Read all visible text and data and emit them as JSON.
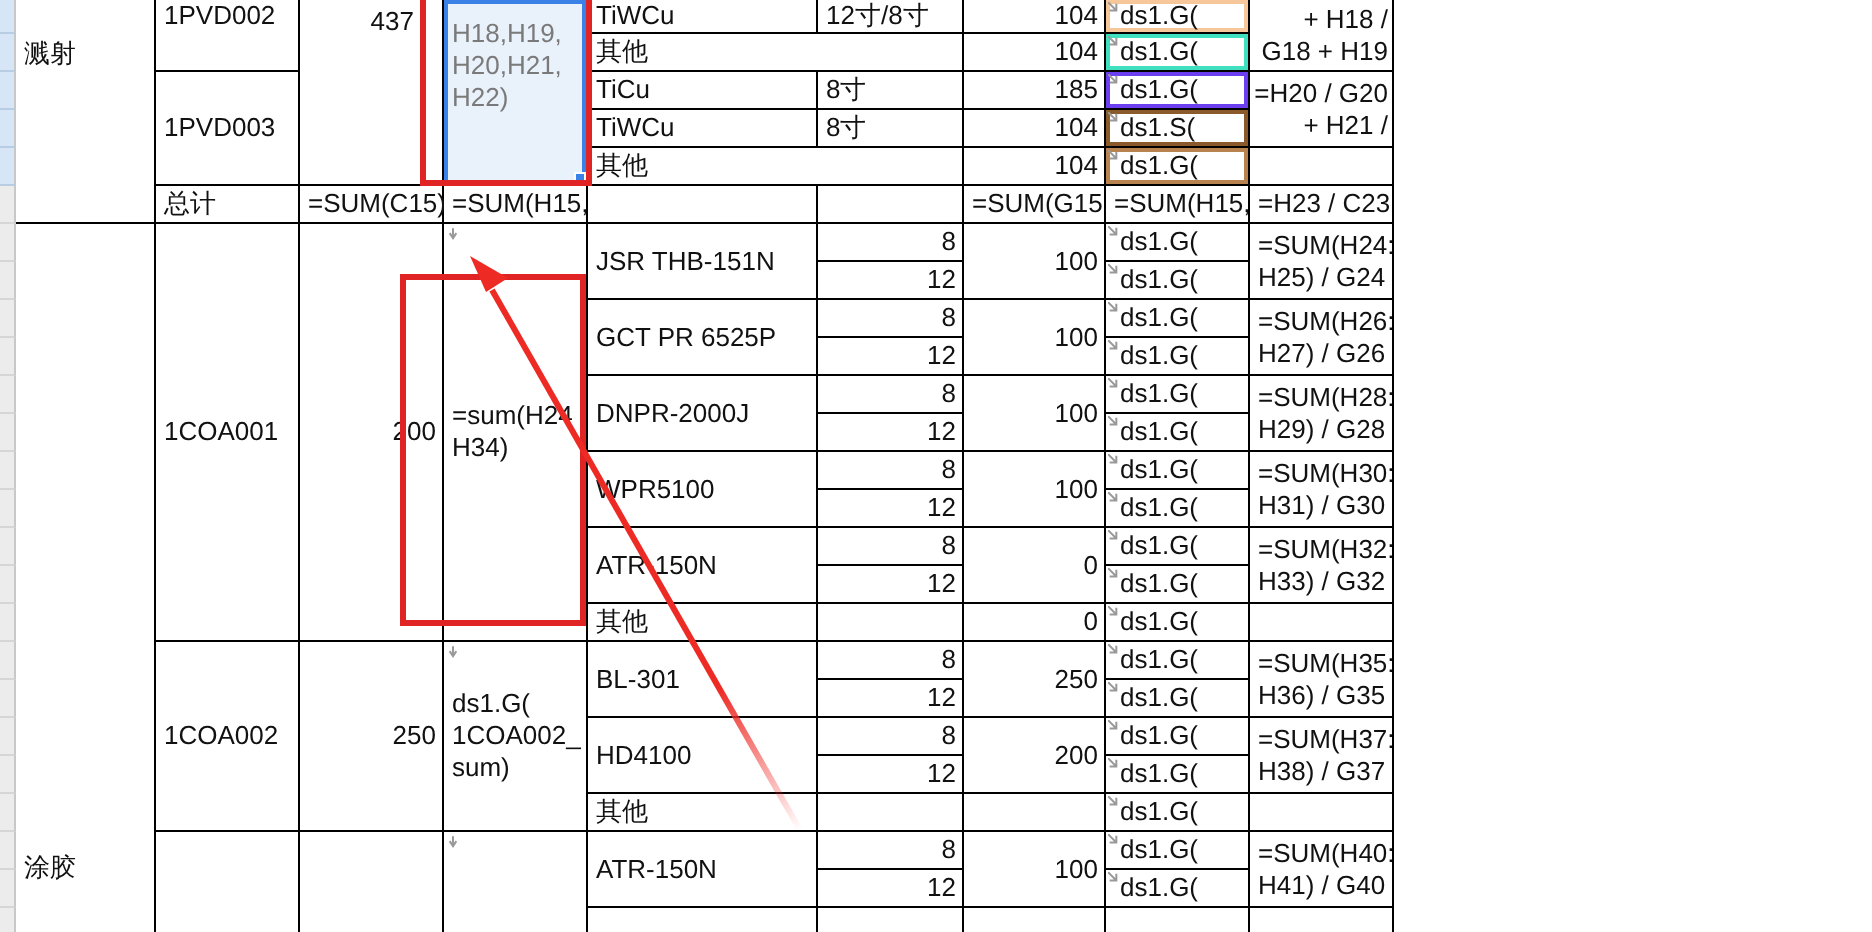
{
  "sheet": {
    "sections": [
      {
        "label": "溅射",
        "continues_above": true,
        "continues_below": false,
        "groups": [
          {
            "qty": "437",
            "formula": [
              "H18,H19,",
              "H20,H21,",
              "H22)"
            ],
            "selected": true,
            "items": [
              {
                "code": "1PVD002",
                "blocks": [
                  {
                    "ratio": [
                      "+ H18 /",
                      "G18 + H19"
                    ],
                    "products": [
                      {
                        "kind": "single",
                        "name": "TiWCu",
                        "amount": "104",
                        "rows": [
                          {
                            "size": "12寸/8寸",
                            "formula": "ds1.G(",
                            "color": "#f5c79a"
                          }
                        ]
                      },
                      {
                        "kind": "other",
                        "name": "其他",
                        "amount": "104",
                        "rows": [
                          {
                            "formula": "ds1.G(",
                            "color": "#3fe0c0"
                          }
                        ]
                      }
                    ]
                  }
                ]
              },
              {
                "code": "1PVD003",
                "blocks": [
                  {
                    "ratio": [
                      "=H20 / G20",
                      "+ H21 /"
                    ],
                    "products": [
                      {
                        "kind": "single",
                        "name": "TiCu",
                        "amount": "185",
                        "rows": [
                          {
                            "size": "8寸",
                            "formula": "ds1.G(",
                            "color": "#6b3ff0"
                          }
                        ]
                      },
                      {
                        "kind": "single",
                        "name": "TiWCu",
                        "amount": "104",
                        "rows": [
                          {
                            "size": "8寸",
                            "formula": "ds1.S(",
                            "color": "#8b5a2b"
                          }
                        ]
                      }
                    ]
                  },
                  {
                    "products": [
                      {
                        "kind": "other",
                        "name": "其他",
                        "amount": "104",
                        "rows": [
                          {
                            "formula": "ds1.G(",
                            "color": "#b8834f"
                          }
                        ]
                      }
                    ]
                  }
                ]
              }
            ]
          }
        ],
        "total": {
          "label": "总计",
          "qty": "=SUM(C15)",
          "formula": "=SUM(H15,",
          "amount": "=SUM(G15,",
          "sum": "=SUM(H15,",
          "ratio": "=H23 / C23"
        }
      },
      {
        "label": "涂胶",
        "continues_above": false,
        "continues_below": true,
        "groups": [
          {
            "qty": "200",
            "formula": [
              "=sum(H24",
              "H34)"
            ],
            "selected": false,
            "items": [
              {
                "code": "1COA001",
                "blocks": [
                  {
                    "ratio": [
                      "=SUM(H24:",
                      "H25) / G24"
                    ],
                    "products": [
                      {
                        "kind": "pair",
                        "name": "JSR THB-151N",
                        "amount": "100",
                        "rows": [
                          {
                            "size": "8",
                            "formula": "ds1.G("
                          },
                          {
                            "size": "12",
                            "formula": "ds1.G("
                          }
                        ]
                      }
                    ]
                  },
                  {
                    "ratio": [
                      "=SUM(H26:",
                      "H27) / G26"
                    ],
                    "products": [
                      {
                        "kind": "pair",
                        "name": "GCT PR 6525P",
                        "amount": "100",
                        "rows": [
                          {
                            "size": "8",
                            "formula": "ds1.G("
                          },
                          {
                            "size": "12",
                            "formula": "ds1.G("
                          }
                        ]
                      }
                    ]
                  },
                  {
                    "ratio": [
                      "=SUM(H28:",
                      "H29) / G28"
                    ],
                    "products": [
                      {
                        "kind": "pair",
                        "name": "DNPR-2000J",
                        "amount": "100",
                        "rows": [
                          {
                            "size": "8",
                            "formula": "ds1.G("
                          },
                          {
                            "size": "12",
                            "formula": "ds1.G("
                          }
                        ]
                      }
                    ]
                  },
                  {
                    "ratio": [
                      "=SUM(H30:",
                      "H31) / G30"
                    ],
                    "products": [
                      {
                        "kind": "pair",
                        "name": "WPR5100",
                        "amount": "100",
                        "rows": [
                          {
                            "size": "8",
                            "formula": "ds1.G("
                          },
                          {
                            "size": "12",
                            "formula": "ds1.G("
                          }
                        ]
                      }
                    ]
                  },
                  {
                    "ratio": [
                      "=SUM(H32:",
                      "H33) / G32"
                    ],
                    "products": [
                      {
                        "kind": "pair",
                        "name": "ATR-150N",
                        "amount": "0",
                        "rows": [
                          {
                            "size": "8",
                            "formula": "ds1.G("
                          },
                          {
                            "size": "12",
                            "formula": "ds1.G("
                          }
                        ]
                      }
                    ]
                  },
                  {
                    "products": [
                      {
                        "kind": "single",
                        "name": "其他",
                        "amount": "0",
                        "rows": [
                          {
                            "formula": "ds1.G("
                          }
                        ]
                      }
                    ]
                  }
                ]
              }
            ]
          },
          {
            "qty": "250",
            "formula": [
              "ds1.G(",
              "1COA002_",
              "sum)"
            ],
            "selected": false,
            "items": [
              {
                "code": "1COA002",
                "blocks": [
                  {
                    "ratio": [
                      "=SUM(H35:",
                      "H36) / G35"
                    ],
                    "products": [
                      {
                        "kind": "pair",
                        "name": "BL-301",
                        "amount": "250",
                        "rows": [
                          {
                            "size": "8",
                            "formula": "ds1.G("
                          },
                          {
                            "size": "12",
                            "formula": "ds1.G("
                          }
                        ]
                      }
                    ]
                  },
                  {
                    "ratio": [
                      "=SUM(H37:",
                      "H38) / G37"
                    ],
                    "products": [
                      {
                        "kind": "pair",
                        "name": "HD4100",
                        "amount": "200",
                        "rows": [
                          {
                            "size": "8",
                            "formula": "ds1.G("
                          },
                          {
                            "size": "12",
                            "formula": "ds1.G("
                          }
                        ]
                      }
                    ]
                  },
                  {
                    "products": [
                      {
                        "kind": "single",
                        "name": "其他",
                        "rows": [
                          {
                            "formula": "ds1.G("
                          }
                        ]
                      }
                    ]
                  }
                ]
              }
            ]
          },
          {
            "selected": false,
            "items": [
              {
                "blocks": [
                  {
                    "ratio": [
                      "=SUM(H40:",
                      "H41) / G40"
                    ],
                    "products": [
                      {
                        "kind": "pair",
                        "name": "ATR-150N",
                        "amount": "100",
                        "rows": [
                          {
                            "size": "8",
                            "formula": "ds1.G("
                          },
                          {
                            "size": "12",
                            "formula": "ds1.G("
                          }
                        ]
                      }
                    ]
                  },
                  {
                    "products": [
                      {
                        "kind": "pair",
                        "rows": [
                          {}
                        ]
                      }
                    ]
                  }
                ]
              }
            ]
          }
        ]
      }
    ]
  },
  "annotations": [
    {
      "kind": "box"
    },
    {
      "kind": "box"
    },
    {
      "kind": "arrow"
    }
  ]
}
